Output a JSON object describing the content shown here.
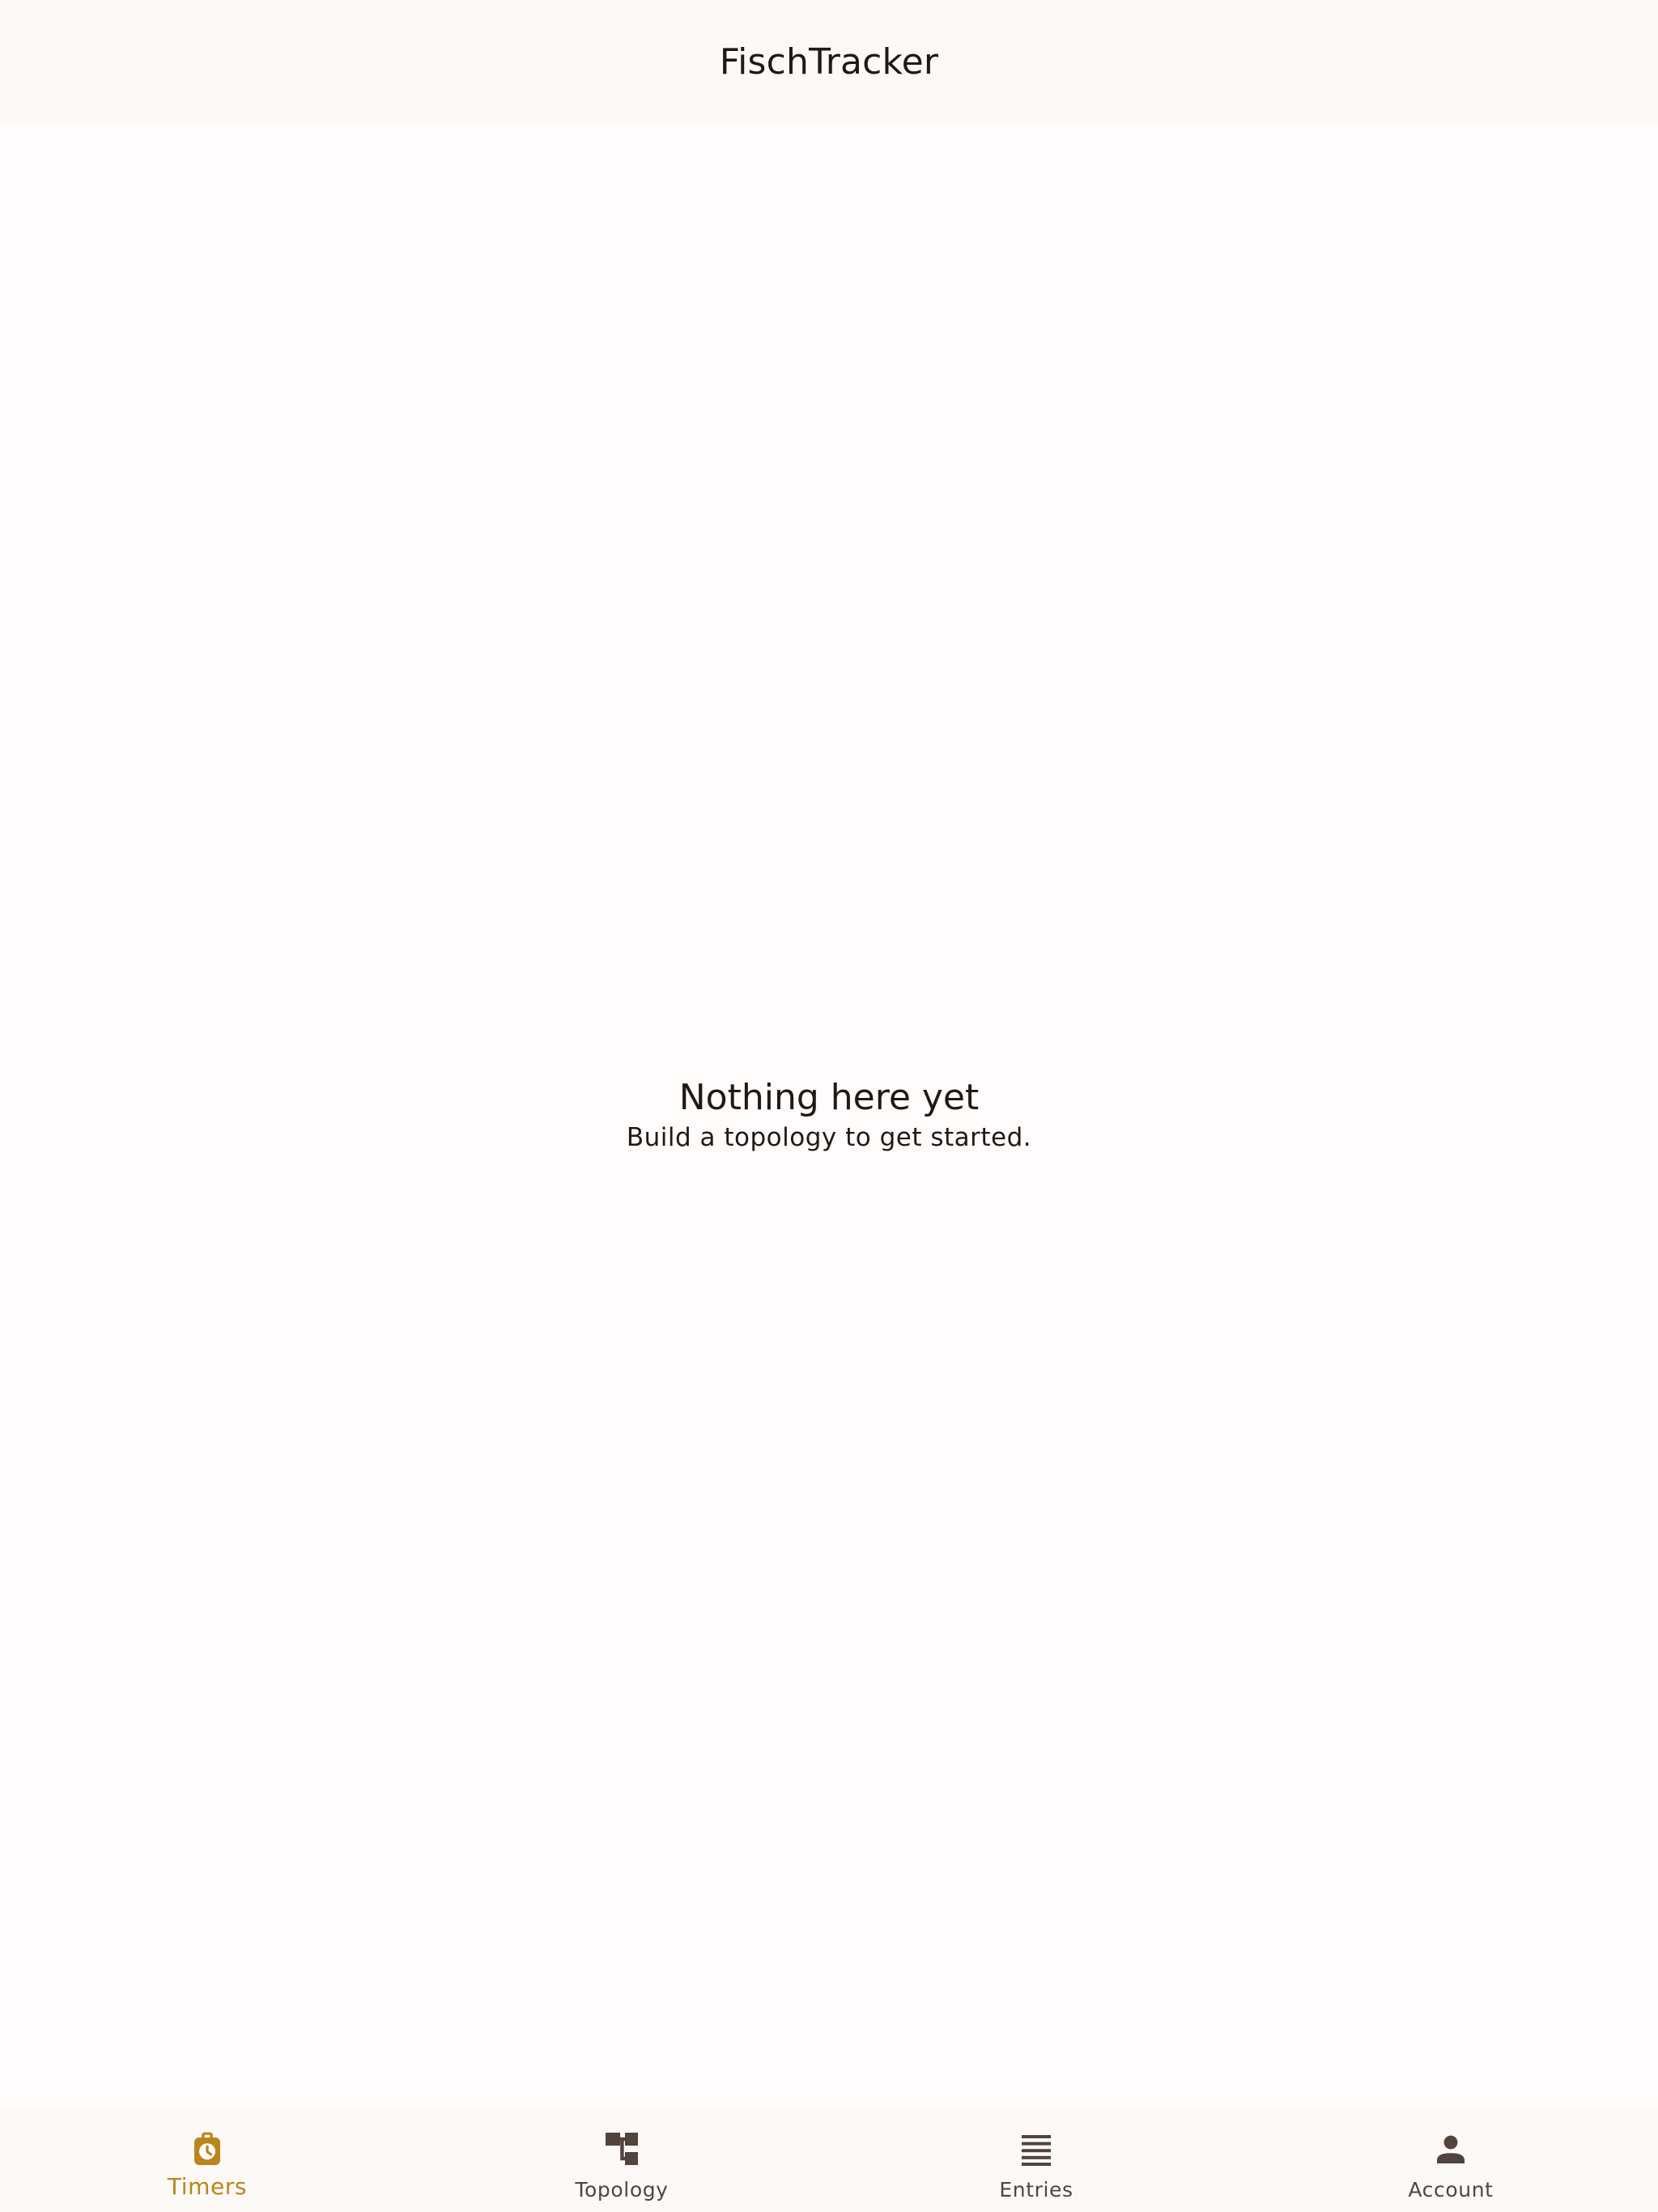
{
  "app": {
    "title": "FischTracker"
  },
  "empty_state": {
    "title": "Nothing here yet",
    "subtitle": "Build a topology to get started."
  },
  "bottom_nav": {
    "items": [
      {
        "label": "Timers",
        "icon": "timer-icon",
        "active": true
      },
      {
        "label": "Topology",
        "icon": "topology-icon",
        "active": false
      },
      {
        "label": "Entries",
        "icon": "list-icon",
        "active": false
      },
      {
        "label": "Account",
        "icon": "person-icon",
        "active": false
      }
    ]
  },
  "colors": {
    "background": "#FFFCFB",
    "bar_background": "#FDF9F6",
    "accent": "#B8861B",
    "inactive": "#52443C",
    "text": "#201A17"
  }
}
